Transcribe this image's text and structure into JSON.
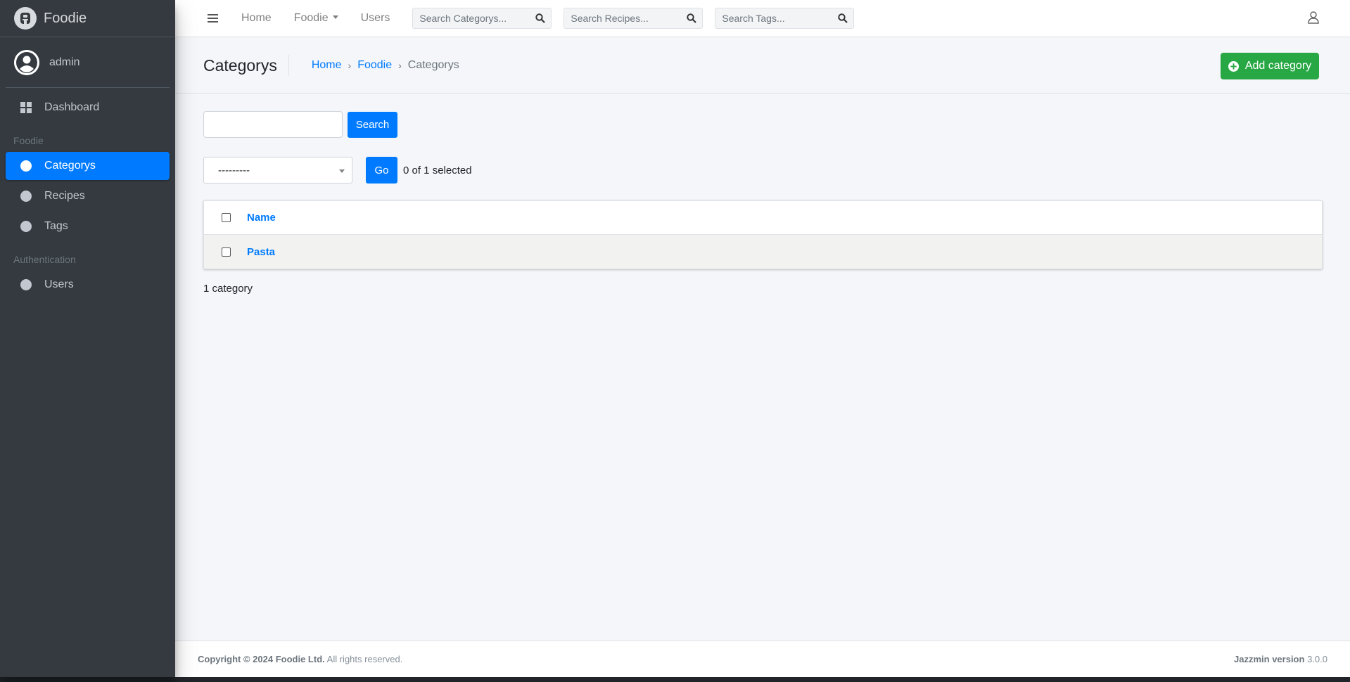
{
  "brand": {
    "name": "Foodie",
    "logo_icon": "jazzmin-logo-icon"
  },
  "user": {
    "name": "admin"
  },
  "sidebar": {
    "dashboard": "Dashboard",
    "sections": [
      {
        "header": "Foodie",
        "items": [
          "Categorys",
          "Recipes",
          "Tags"
        ]
      },
      {
        "header": "Authentication",
        "items": [
          "Users"
        ]
      }
    ],
    "active_item": "Categorys"
  },
  "navbar": {
    "links": [
      "Home",
      "Foodie",
      "Users"
    ],
    "search_placeholders": [
      "Search Categorys...",
      "Search Recipes...",
      "Search Tags..."
    ]
  },
  "header": {
    "title": "Categorys",
    "breadcrumb": [
      "Home",
      "Foodie",
      "Categorys"
    ],
    "add_button": "Add category"
  },
  "main": {
    "search_value": "",
    "search_button": "Search",
    "action_select": "---------",
    "go_button": "Go",
    "selected_text": "0 of 1 selected",
    "table": {
      "columns": [
        "Name"
      ],
      "rows": [
        {
          "name": "Pasta"
        }
      ]
    },
    "result_count": "1 category"
  },
  "footer": {
    "copyright_strong": "Copyright © 2024 Foodie Ltd.",
    "copyright_rest": "All rights reserved.",
    "version_label": "Jazzmin version",
    "version": "3.0.0"
  },
  "colors": {
    "sidebar_bg": "#343a40",
    "primary": "#007bff",
    "success": "#28a745",
    "page_bg": "#f4f6f9"
  }
}
